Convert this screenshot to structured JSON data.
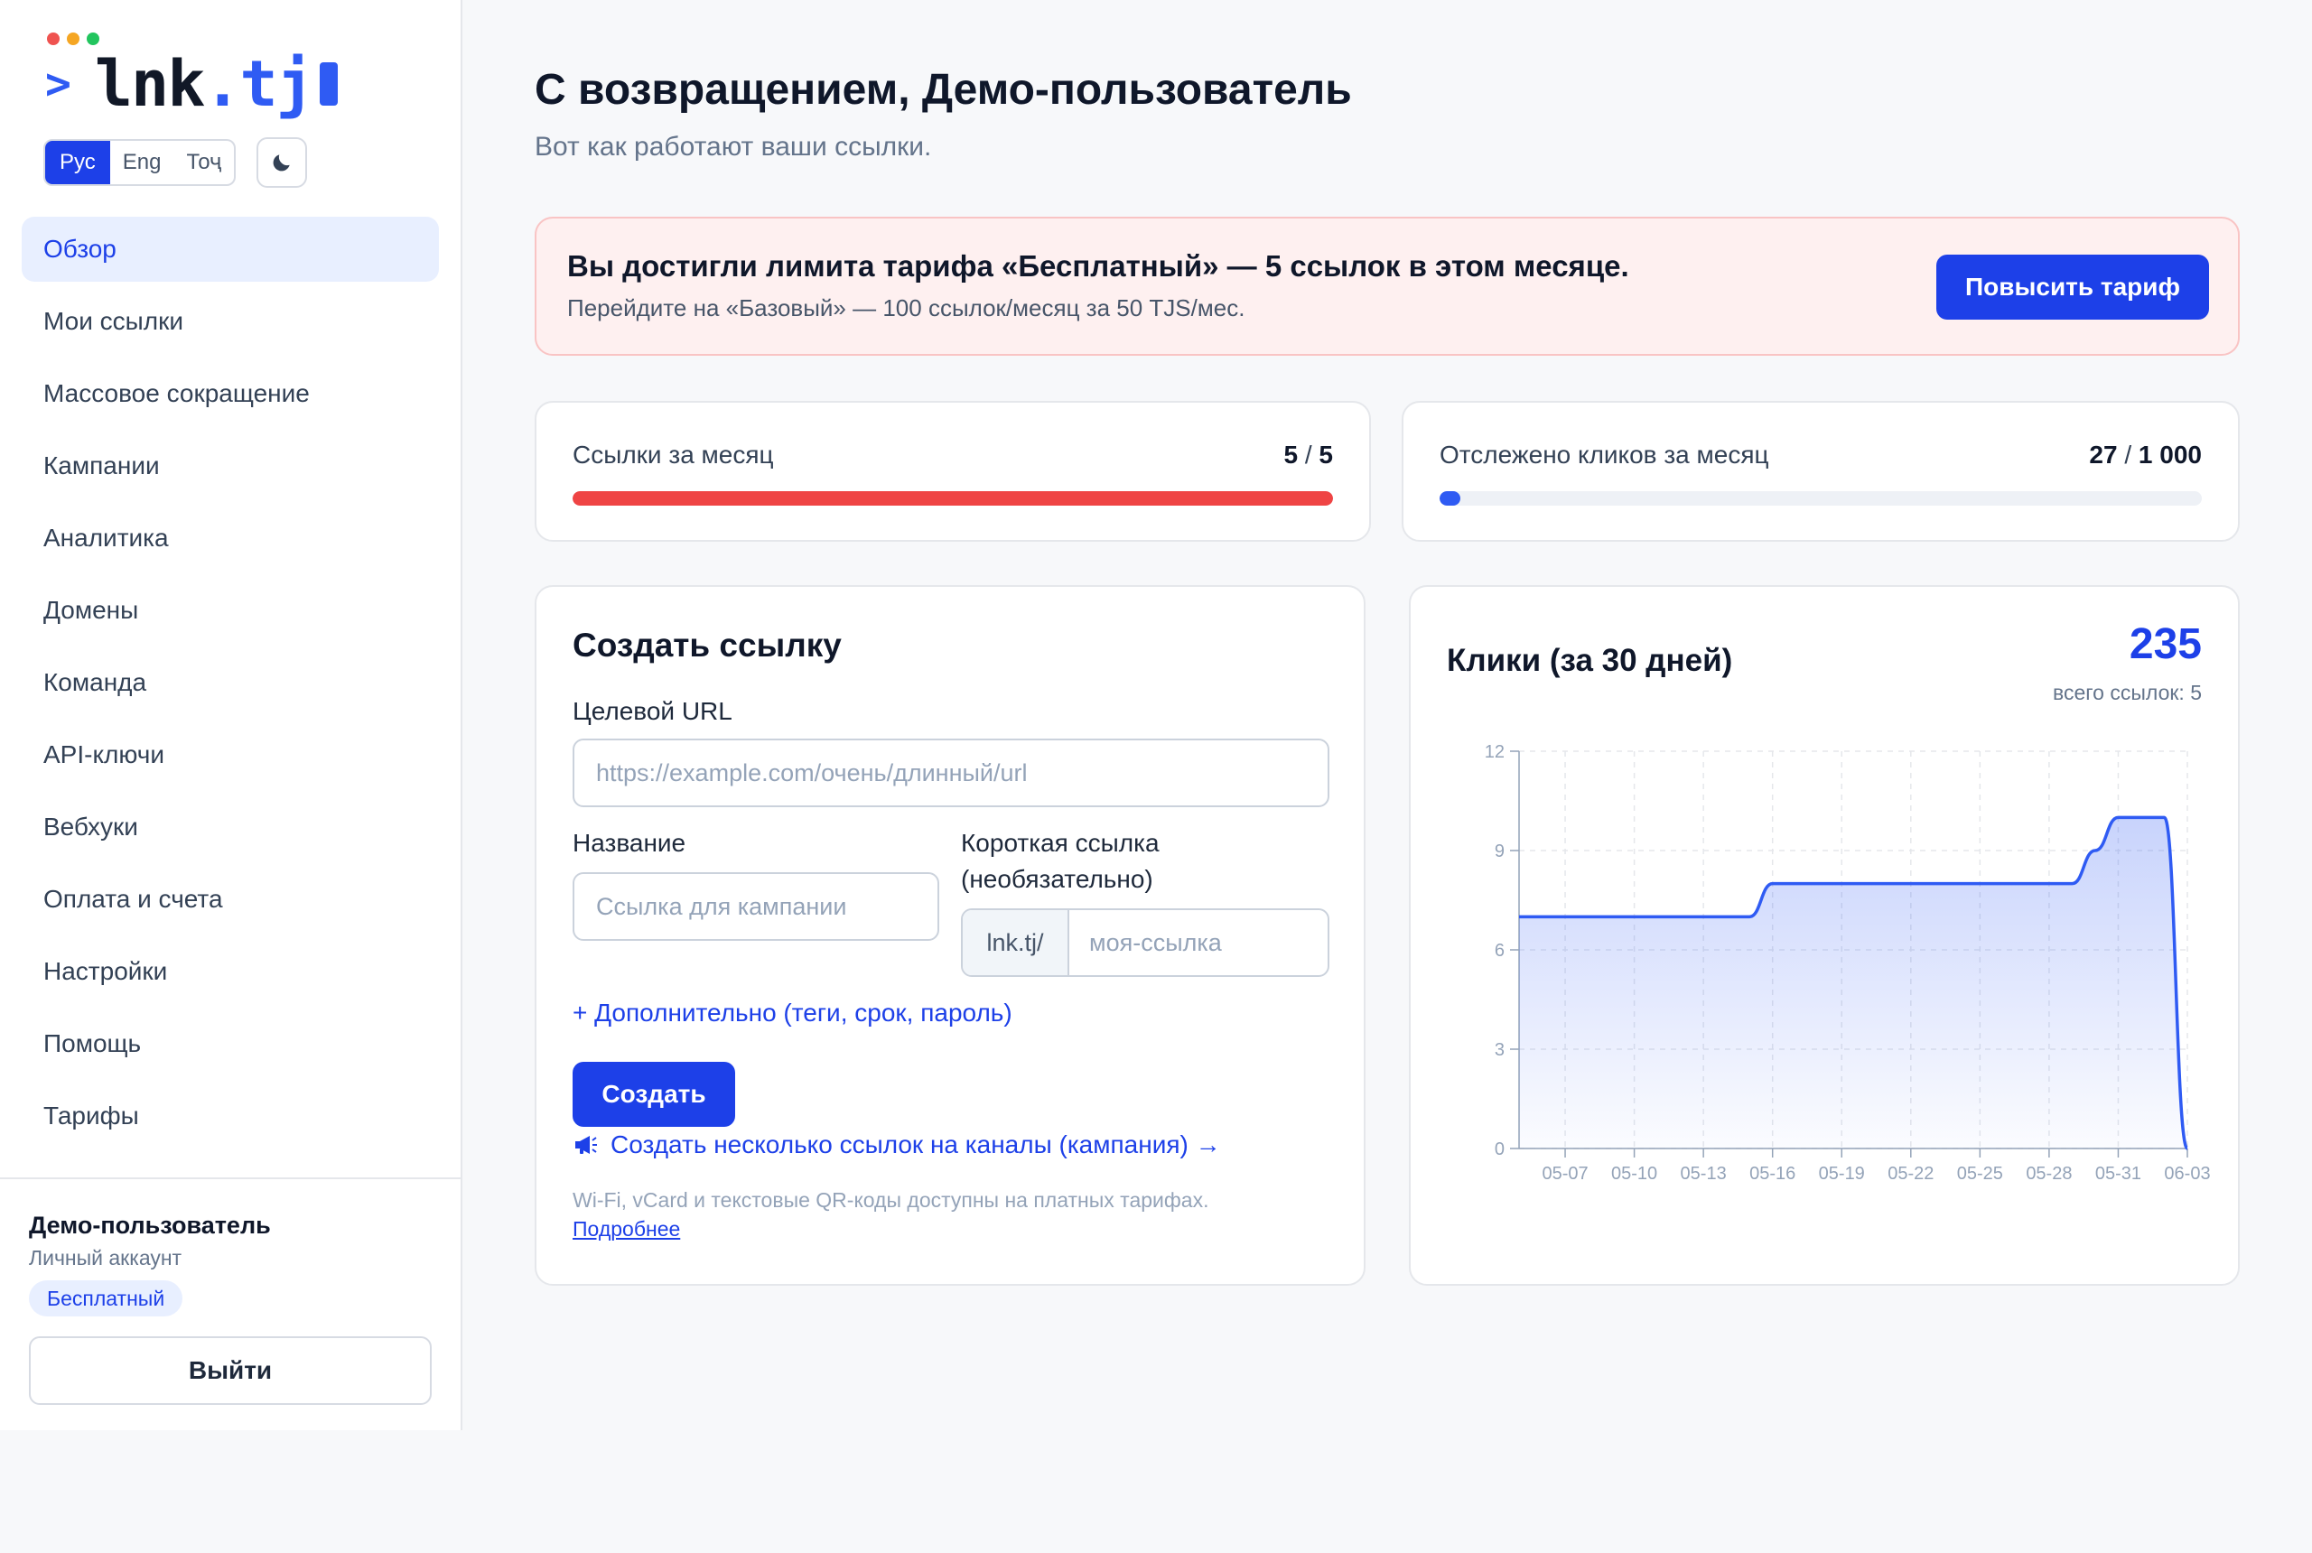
{
  "colors": {
    "accent": "#1d40e8",
    "danger": "#ef4444",
    "progress_blue": "#2f5bf3"
  },
  "logo": {
    "prompt": ">",
    "name": "lnk",
    "dot": ".",
    "tld": "tj"
  },
  "languages": [
    {
      "label": "Рус",
      "active": true
    },
    {
      "label": "Eng",
      "active": false
    },
    {
      "label": "Тоҷ",
      "active": false
    }
  ],
  "nav": [
    {
      "label": "Обзор",
      "active": true
    },
    {
      "label": "Мои ссылки"
    },
    {
      "label": "Массовое сокращение"
    },
    {
      "label": "Кампании"
    },
    {
      "label": "Аналитика"
    },
    {
      "label": "Домены"
    },
    {
      "label": "Команда"
    },
    {
      "label": "API-ключи"
    },
    {
      "label": "Вебхуки"
    },
    {
      "label": "Оплата и счета"
    },
    {
      "label": "Настройки"
    },
    {
      "label": "Помощь"
    },
    {
      "label": "Тарифы"
    }
  ],
  "user": {
    "name": "Демо-пользователь",
    "type": "Личный аккаунт",
    "plan": "Бесплатный",
    "logout_label": "Выйти"
  },
  "header": {
    "title": "С возвращением, Демо-пользователь",
    "subtitle": "Вот как работают ваши ссылки."
  },
  "alert": {
    "title": "Вы достигли лимита тарифа «Бесплатный» — 5 ссылок в этом месяце.",
    "text": "Перейдите на «Базовый» — 100 ссылок/месяц за 50 TJS/мес.",
    "button": "Повысить тариф"
  },
  "stats": {
    "links": {
      "label": "Ссылки за месяц",
      "used": "5",
      "limit": "5",
      "fraction": 1.0
    },
    "clicks": {
      "label": "Отслежено кликов за месяц",
      "used": "27",
      "limit": "1 000",
      "fraction": 0.027
    }
  },
  "create": {
    "title": "Создать ссылку",
    "url_label": "Целевой URL",
    "url_placeholder": "https://example.com/очень/длинный/url",
    "name_label": "Название",
    "name_placeholder": "Ссылка для кампании",
    "short_label_line1": "Короткая ссылка",
    "short_label_line2": "(необязательно)",
    "short_prefix": "lnk.tj/",
    "short_placeholder": "моя-ссылка",
    "advanced": "+ Дополнительно (теги, срок, пароль)",
    "button": "Создать",
    "campaign_link": "Создать несколько ссылок на каналы (кампания) →",
    "note": "Wi-Fi, vCard и текстовые QR-коды доступны на платных тарифах.",
    "more": "Подробнее"
  },
  "chart_card": {
    "title": "Клики (за 30 дней)",
    "total": "235",
    "sub": "всего ссылок: 5"
  },
  "chart_data": {
    "type": "area",
    "title": "Клики (за 30 дней)",
    "x": [
      "05-05",
      "05-06",
      "05-07",
      "05-08",
      "05-09",
      "05-10",
      "05-11",
      "05-12",
      "05-13",
      "05-14",
      "05-15",
      "05-16",
      "05-17",
      "05-18",
      "05-19",
      "05-20",
      "05-21",
      "05-22",
      "05-23",
      "05-24",
      "05-25",
      "05-26",
      "05-27",
      "05-28",
      "05-29",
      "05-30",
      "05-31",
      "06-01",
      "06-02",
      "06-03"
    ],
    "tick_labels": [
      "05-07",
      "05-10",
      "05-13",
      "05-16",
      "05-19",
      "05-22",
      "05-25",
      "05-28",
      "05-31",
      "06-03"
    ],
    "values": [
      7,
      7,
      7,
      7,
      7,
      7,
      7,
      7,
      7,
      7,
      7,
      8,
      8,
      8,
      8,
      8,
      8,
      8,
      8,
      8,
      8,
      8,
      8,
      8,
      8,
      9,
      10,
      10,
      10,
      0
    ],
    "yticks": [
      0,
      3,
      6,
      9,
      12
    ],
    "ylim": [
      0,
      12
    ],
    "grid": true
  }
}
